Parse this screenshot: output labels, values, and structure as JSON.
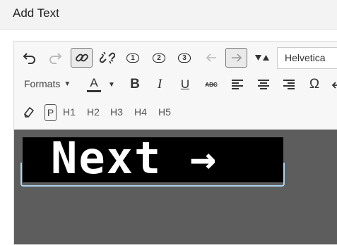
{
  "dialog": {
    "title": "Add Text"
  },
  "toolbar": {
    "font_family": "Helvetica",
    "formats_label": "Formats",
    "link_pills": [
      "1",
      "2",
      "3"
    ],
    "text_color_letter": "A",
    "bold": "B",
    "italic": "I",
    "underline": "U",
    "strikethrough": "ABC",
    "omega": "Ω",
    "paragraph": "P",
    "headings": [
      "H1",
      "H2",
      "H3",
      "H4",
      "H5"
    ]
  },
  "content": {
    "image_text": "Next →"
  }
}
